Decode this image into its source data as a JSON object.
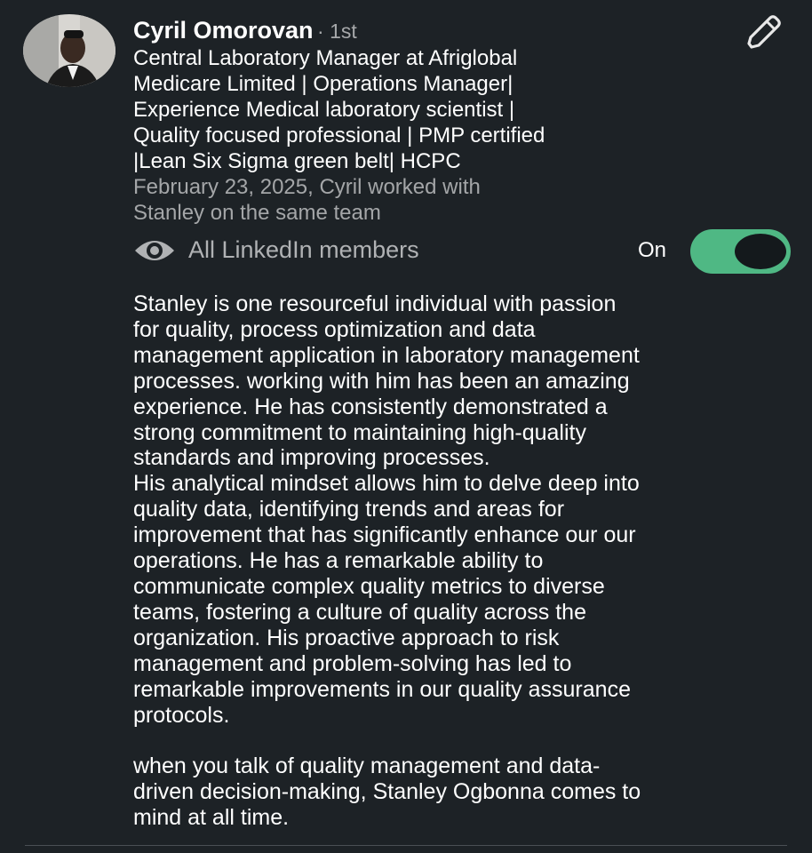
{
  "recommender": {
    "name": "Cyril Omorovan",
    "degree": "· 1st",
    "headline_lines": [
      "Central Laboratory Manager at Afriglobal",
      "Medicare Limited | Operations Manager|",
      "Experience Medical laboratory scientist |",
      "Quality focused professional | PMP certified",
      "|Lean Six Sigma green belt| HCPC"
    ],
    "meta_lines": [
      "February 23, 2025, Cyril worked with",
      "Stanley on the same team"
    ]
  },
  "visibility": {
    "icon": "eye-icon",
    "label": "All LinkedIn members",
    "toggle_label": "On",
    "toggle_on": true,
    "toggle_color": "#4fb884"
  },
  "edit_icon": "pencil-icon",
  "recommendation_lines": [
    "Stanley is one resourceful individual with passion",
    "for quality, process optimization and data",
    "management application in laboratory management",
    "processes. working with him has been an amazing",
    "experience.  He has consistently demonstrated a",
    "strong commitment to maintaining high-quality",
    "standards and improving processes.",
    "His analytical mindset allows him to delve deep into",
    "quality data, identifying trends and areas for",
    "improvement that has significantly enhance our our",
    "operations. He has a remarkable ability to",
    "communicate complex quality metrics to diverse",
    "teams, fostering a culture of quality across the",
    "organization. His proactive approach to risk",
    "management and problem-solving has led to",
    "remarkable improvements in our quality assurance",
    "protocols.",
    "",
    "when  you talk of quality management and data-",
    "driven decision-making, Stanley Ogbonna comes to",
    "mind at all time."
  ]
}
